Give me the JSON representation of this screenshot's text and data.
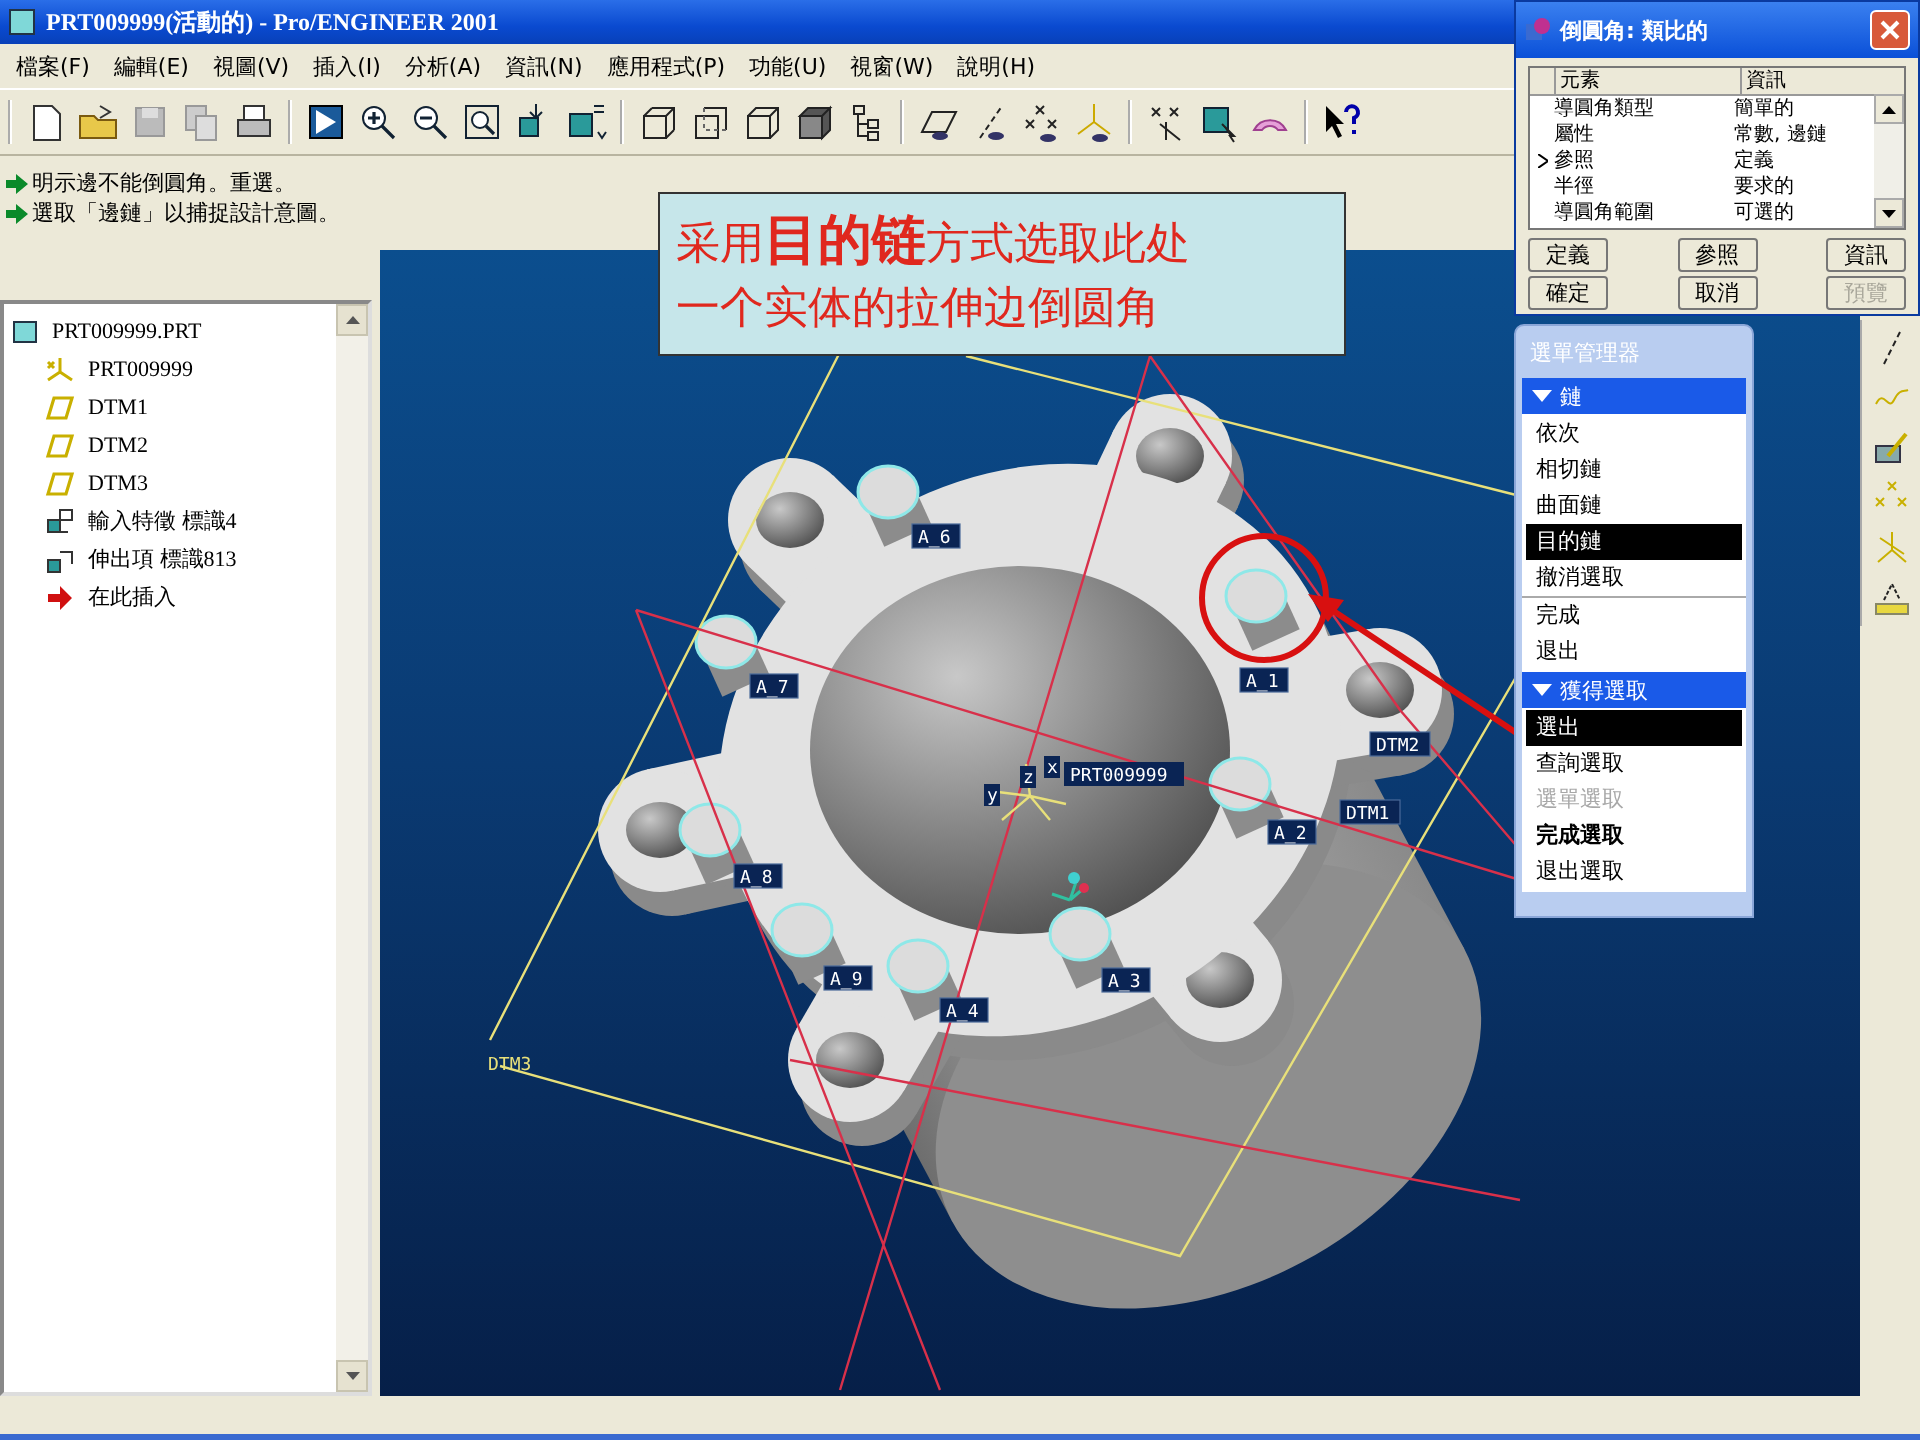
{
  "window": {
    "title": "PRT009999(活動的) - Pro/ENGINEER 2001"
  },
  "menu": [
    "檔案(F)",
    "編輯(E)",
    "視圖(V)",
    "插入(I)",
    "分析(A)",
    "資訊(N)",
    "應用程式(P)",
    "功能(U)",
    "視窗(W)",
    "說明(H)"
  ],
  "messages": [
    "明示邊不能倒圓角。重選。",
    "選取「邊鏈」以捕捉設計意圖。"
  ],
  "tree": {
    "root": "PRT009999.PRT",
    "children": [
      {
        "label": "PRT009999",
        "kind": "csys"
      },
      {
        "label": "DTM1",
        "kind": "datum"
      },
      {
        "label": "DTM2",
        "kind": "datum"
      },
      {
        "label": "DTM3",
        "kind": "datum"
      },
      {
        "label": "輸入特徵 標識4",
        "kind": "import"
      },
      {
        "label": "伸出項 標識813",
        "kind": "protrusion"
      },
      {
        "label": "在此插入",
        "kind": "insert"
      }
    ]
  },
  "callout": {
    "lines": [
      "采用**目的链**方式选取此处",
      "一个实体的拉伸边倒圆角"
    ]
  },
  "viewport": {
    "labels": [
      {
        "text": "A_6",
        "kind": "axis"
      },
      {
        "text": "A_7",
        "kind": "axis"
      },
      {
        "text": "A_1",
        "kind": "axis"
      },
      {
        "text": "DTM2",
        "kind": "datum"
      },
      {
        "text": "A_2",
        "kind": "axis"
      },
      {
        "text": "DTM1",
        "kind": "datum"
      },
      {
        "text": "A_8",
        "kind": "axis"
      },
      {
        "text": "A_9",
        "kind": "axis"
      },
      {
        "text": "A_4",
        "kind": "axis"
      },
      {
        "text": "A_3",
        "kind": "axis"
      },
      {
        "text": "DTM3",
        "kind": "plane"
      }
    ],
    "csys": {
      "name": "PRT009999",
      "axes": [
        "x",
        "z",
        "y"
      ]
    }
  },
  "dialog": {
    "title": "倒圓角: 類比的",
    "columns": [
      "元素",
      "資訊"
    ],
    "rows": [
      {
        "element": "導圓角類型",
        "info": "簡單的",
        "current": false
      },
      {
        "element": "屬性",
        "info": "常數, 邊鏈",
        "current": false
      },
      {
        "element": "參照",
        "info": "定義",
        "current": true
      },
      {
        "element": "半徑",
        "info": "要求的",
        "current": false
      },
      {
        "element": "導圓角範圍",
        "info": "可選的",
        "current": false
      }
    ],
    "buttons": [
      {
        "label": "定義",
        "disabled": false
      },
      {
        "label": "參照",
        "disabled": false
      },
      {
        "label": "資訊",
        "disabled": false
      },
      {
        "label": "確定",
        "disabled": false
      },
      {
        "label": "取消",
        "disabled": false
      },
      {
        "label": "預覽",
        "disabled": true
      }
    ]
  },
  "menu_manager": {
    "title": "選單管理器",
    "sections": [
      {
        "title": "鏈",
        "items": [
          {
            "label": "依次",
            "selected": false,
            "disabled": false,
            "bold": false,
            "separator_before": false
          },
          {
            "label": "相切鏈",
            "selected": false,
            "disabled": false,
            "bold": false,
            "separator_before": false
          },
          {
            "label": "曲面鏈",
            "selected": false,
            "disabled": false,
            "bold": false,
            "separator_before": false
          },
          {
            "label": "目的鏈",
            "selected": true,
            "disabled": false,
            "bold": false,
            "separator_before": false
          },
          {
            "label": "撤消選取",
            "selected": false,
            "disabled": false,
            "bold": false,
            "separator_before": false
          },
          {
            "label": "完成",
            "selected": false,
            "disabled": false,
            "bold": false,
            "separator_before": true
          },
          {
            "label": "退出",
            "selected": false,
            "disabled": false,
            "bold": false,
            "separator_before": false
          }
        ]
      },
      {
        "title": "獲得選取",
        "items": [
          {
            "label": "選出",
            "selected": true,
            "disabled": false,
            "bold": false,
            "separator_before": false
          },
          {
            "label": "查詢選取",
            "selected": false,
            "disabled": false,
            "bold": false,
            "separator_before": false
          },
          {
            "label": "選單選取",
            "selected": false,
            "disabled": true,
            "bold": false,
            "separator_before": false
          },
          {
            "label": "完成選取",
            "selected": false,
            "disabled": false,
            "bold": true,
            "separator_before": false
          },
          {
            "label": "退出選取",
            "selected": false,
            "disabled": false,
            "bold": false,
            "separator_before": false
          }
        ]
      }
    ]
  }
}
